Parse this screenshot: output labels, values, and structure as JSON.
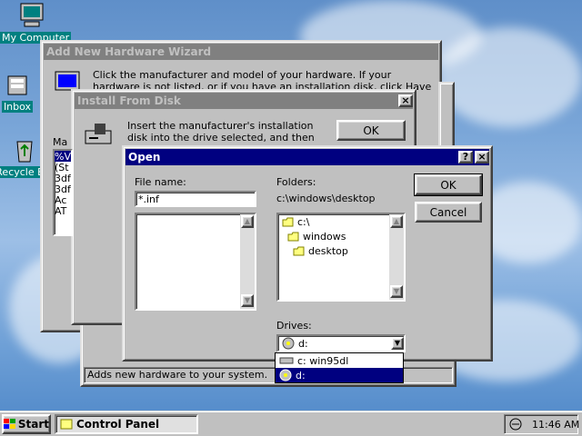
{
  "desktop": {
    "icons": [
      {
        "label": "My Computer"
      },
      {
        "label": "Inbox"
      },
      {
        "label": "Recycle Bin"
      }
    ]
  },
  "wizard": {
    "title": "Add New Hardware Wizard",
    "instruction": "Click the manufacturer and model of your hardware. If your hardware is not listed, or if you have an installation disk, click Have Disk.",
    "manufacturers_label": "Manufacturers:",
    "manufacturers": [
      "%V",
      "(St",
      "3df",
      "3df",
      "Ac",
      "AT"
    ],
    "status_text": "Adds new hardware to your system."
  },
  "install_from_disk": {
    "title": "Install From Disk",
    "message": "Insert the manufacturer's installation disk into the drive selected, and then click OK.",
    "ok_label": "OK"
  },
  "open_dialog": {
    "title": "Open",
    "help_label": "?",
    "close_label": "×",
    "file_name_label": "File name:",
    "file_name_value": "*.inf",
    "folders_label": "Folders:",
    "current_path": "c:\\windows\\desktop",
    "folders": [
      "c:\\",
      "windows",
      "desktop"
    ],
    "drives_label": "Drives:",
    "selected_drive": "d:",
    "drive_options": [
      "c: win95dl",
      "d:"
    ],
    "ok_label": "OK",
    "cancel_label": "Cancel"
  },
  "taskbar": {
    "start_label": "Start",
    "task_label": "Control Panel",
    "clock": "11:46 AM"
  },
  "colors": {
    "title_active": "#000080",
    "title_inactive": "#808080",
    "face": "#c0c0c0",
    "desktop": "#6d9fd6"
  }
}
